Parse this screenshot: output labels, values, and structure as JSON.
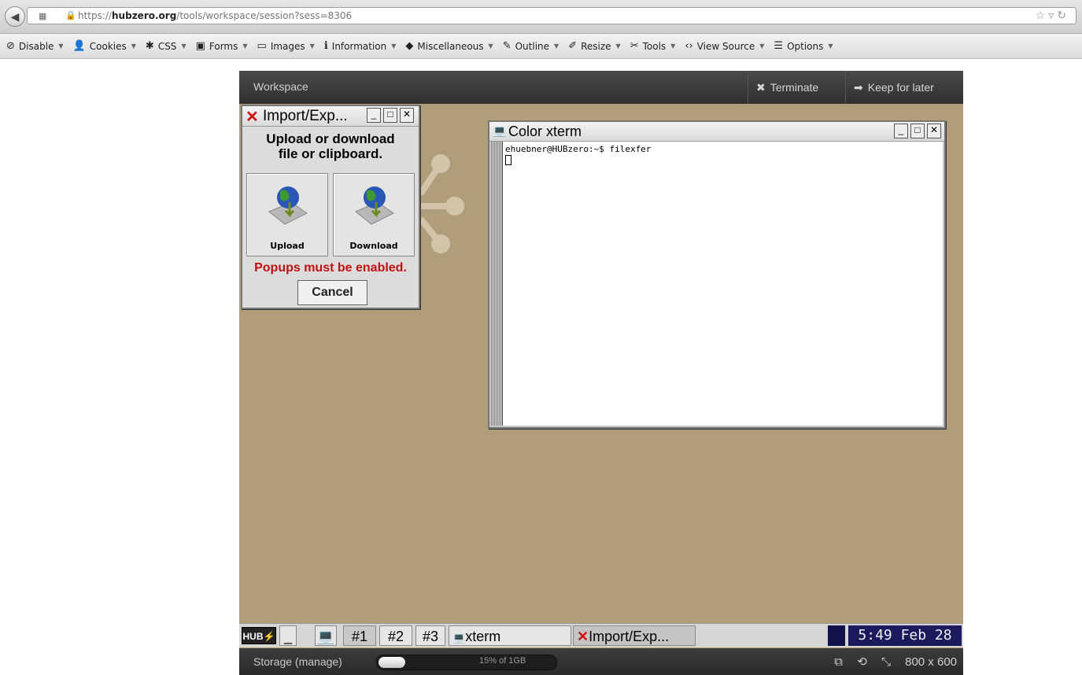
{
  "browser": {
    "url_prefix": "https://",
    "url_host": "hubzero.org",
    "url_path": "/tools/workspace/session?sess=8306"
  },
  "devbar": {
    "items": [
      {
        "label": "Disable",
        "icon": "disable-icon",
        "glyph": "⊘"
      },
      {
        "label": "Cookies",
        "icon": "person-icon",
        "glyph": "👤"
      },
      {
        "label": "CSS",
        "icon": "wand-icon",
        "glyph": "✱"
      },
      {
        "label": "Forms",
        "icon": "clipboard-icon",
        "glyph": "▣"
      },
      {
        "label": "Images",
        "icon": "image-icon",
        "glyph": "▭"
      },
      {
        "label": "Information",
        "icon": "info-icon",
        "glyph": "ℹ"
      },
      {
        "label": "Miscellaneous",
        "icon": "cube-icon",
        "glyph": "◆"
      },
      {
        "label": "Outline",
        "icon": "pencil-icon",
        "glyph": "✎"
      },
      {
        "label": "Resize",
        "icon": "ruler-icon",
        "glyph": "✐"
      },
      {
        "label": "Tools",
        "icon": "wrench-icon",
        "glyph": "✂"
      },
      {
        "label": "View Source",
        "icon": "code-icon",
        "glyph": "‹›"
      },
      {
        "label": "Options",
        "icon": "sliders-icon",
        "glyph": "☰"
      }
    ]
  },
  "workspace": {
    "title": "Workspace",
    "terminate_label": "Terminate",
    "keep_label": "Keep for later"
  },
  "xterm": {
    "title": "Color xterm",
    "prompt_line": "ehuebner@HUBzero:~$ filexfer"
  },
  "impexp": {
    "title": "Import/Exp...",
    "heading_line1": "Upload or download",
    "heading_line2": "file or clipboard.",
    "upload_label": "Upload",
    "download_label": "Download",
    "warning": "Popups must be enabled.",
    "cancel_label": "Cancel"
  },
  "taskbar": {
    "logo": "HUB",
    "minimize": "_",
    "desk1": "#1",
    "desk2": "#2",
    "desk3": "#3",
    "task_xterm": "xterm",
    "task_impexp": "Import/Exp...",
    "clock": "5:49 Feb 28"
  },
  "storage": {
    "label": "Storage (manage)",
    "percent_text": "15% of 1GB",
    "fill_fraction": 0.15,
    "resolution": "800 x 600"
  }
}
